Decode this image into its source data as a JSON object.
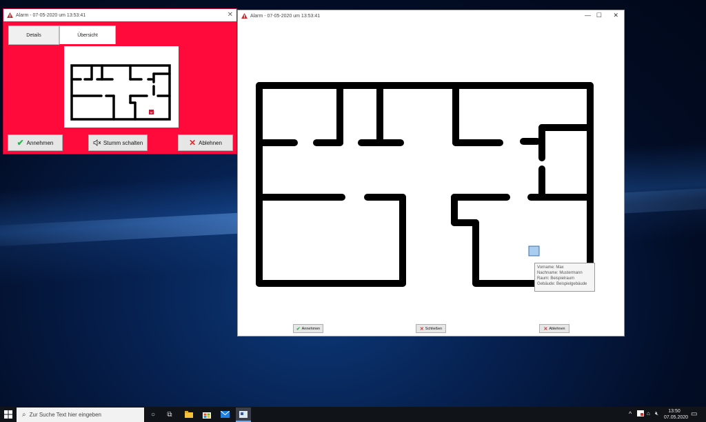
{
  "small_window": {
    "title": "Alarm - 07-05-2020 um 13:53:41",
    "tabs": [
      {
        "label": "Details"
      },
      {
        "label": "Übersicht"
      }
    ],
    "plan_marker_label": "M",
    "buttons": {
      "accept": "Annehmen",
      "mute": "Stumm schalten",
      "reject": "Ablehnen"
    }
  },
  "large_window": {
    "title": "Alarm - 07-05-2020 um 13:53:41",
    "tooltip": {
      "lines": [
        "Vorname: Max",
        "Nachname: Mustermann",
        "Raum: Beispielraum",
        "Gebäude: Beispielgebäude"
      ]
    },
    "buttons": {
      "accept": "Annehmen",
      "close": "Schließen",
      "reject": "Ablehnen"
    }
  },
  "taskbar": {
    "search_placeholder": "Zur Suche Text hier eingeben",
    "time": "13:50",
    "date": "07.05.2020"
  },
  "colors": {
    "alarm_red": "#ff0a3a",
    "marker_fill": "#a9cdf0",
    "accept_green": "#2bb24c",
    "reject_red": "#e0282c"
  }
}
